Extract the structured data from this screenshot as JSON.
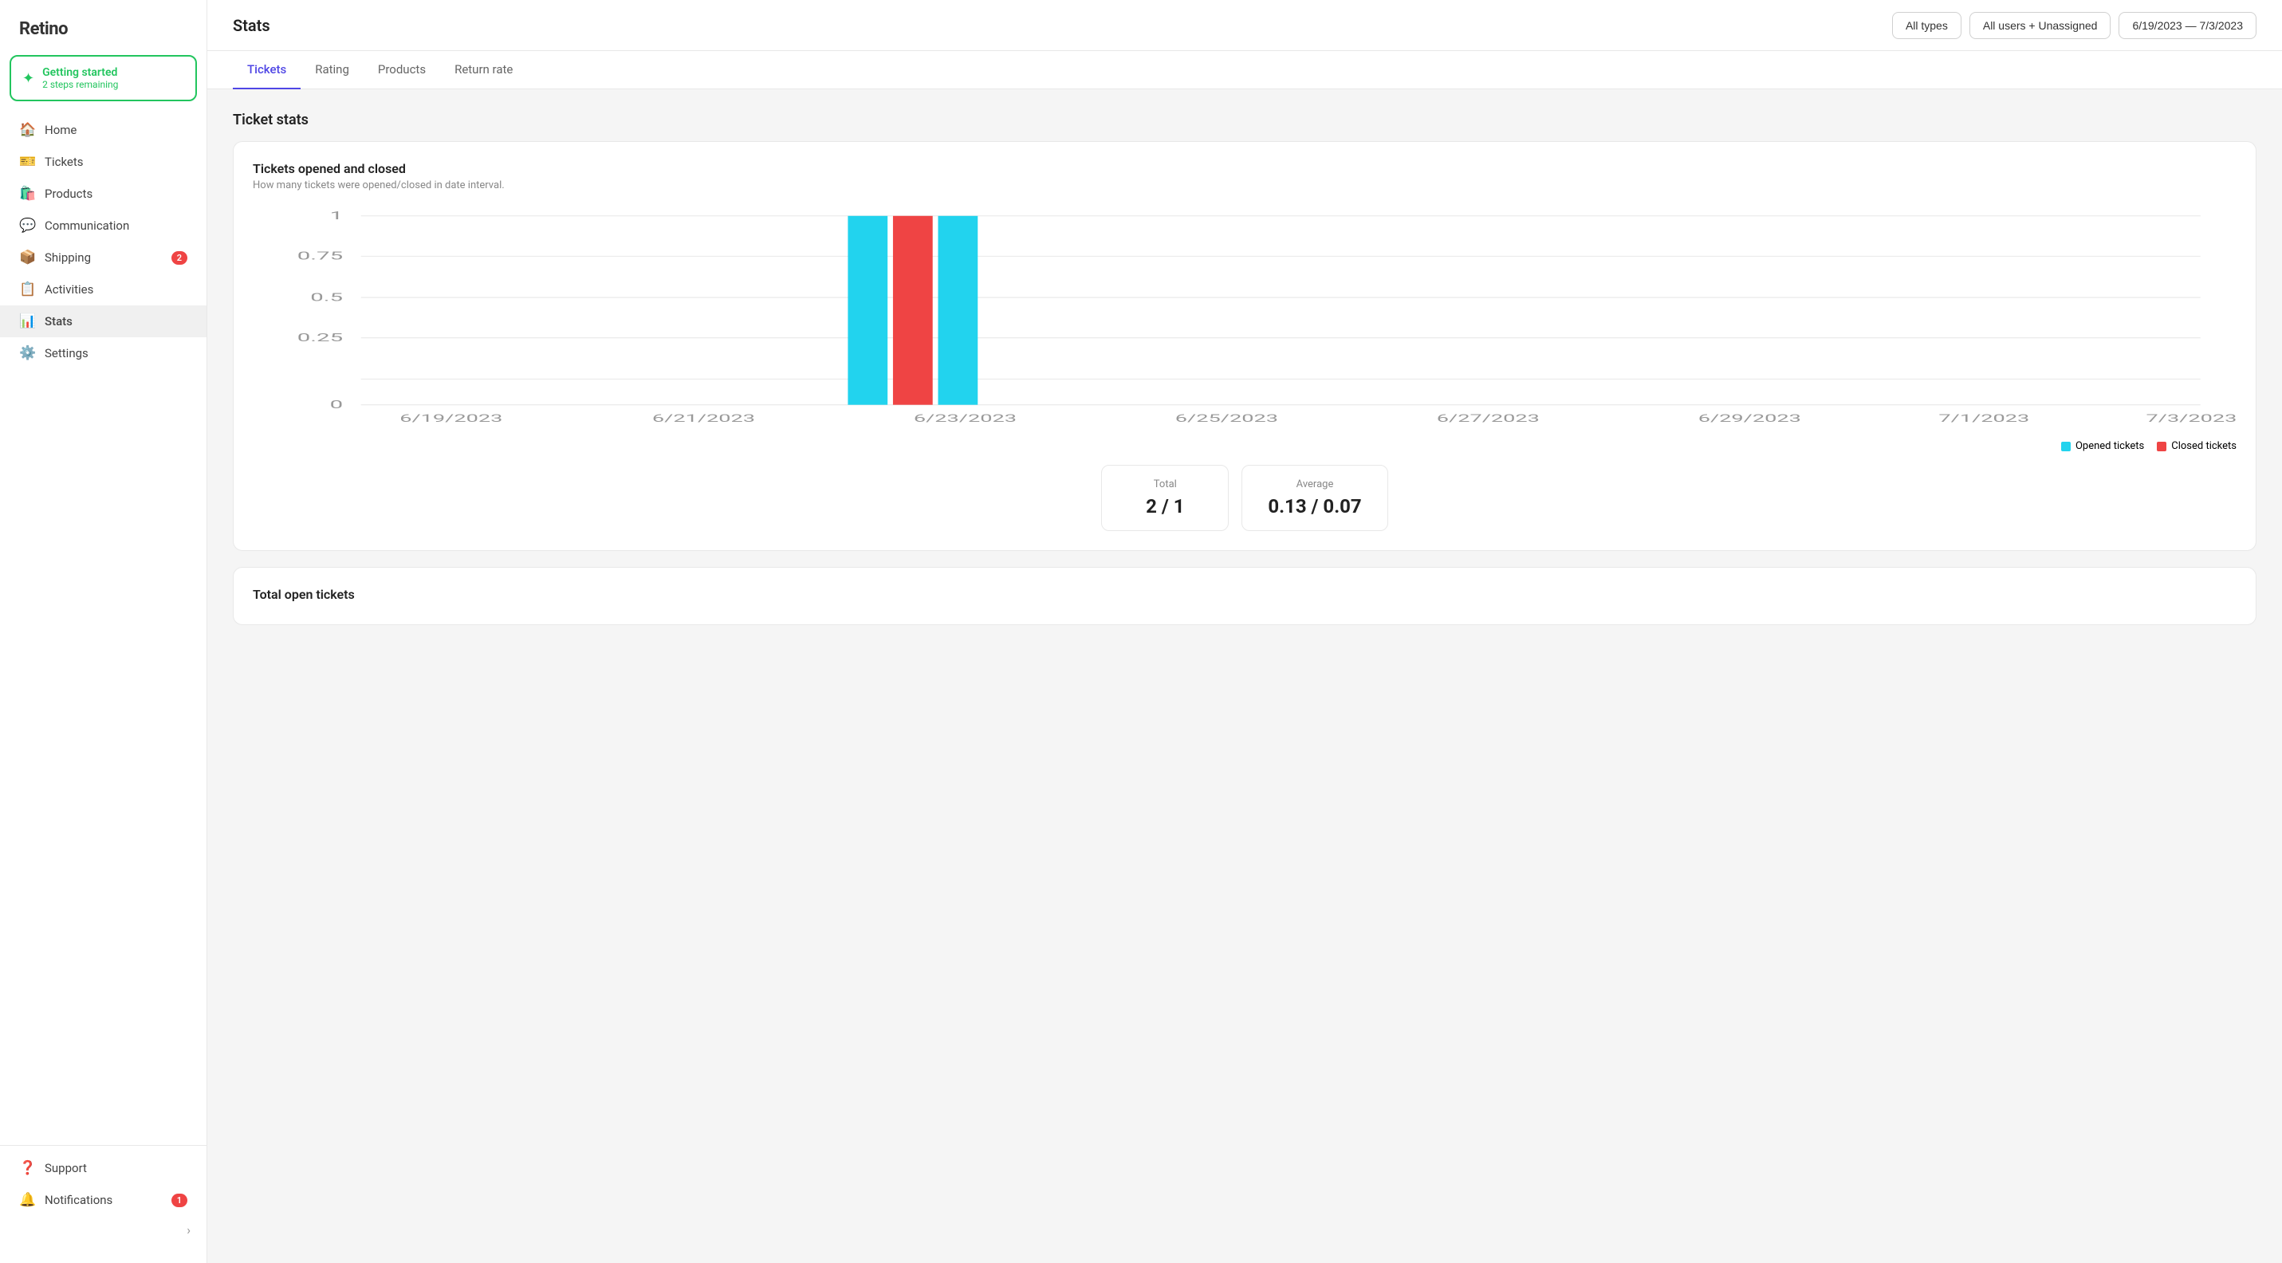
{
  "sidebar": {
    "logo": "Retino",
    "getting_started": {
      "title": "Getting started",
      "subtitle": "2 steps remaining"
    },
    "nav_items": [
      {
        "id": "home",
        "label": "Home",
        "icon": "🏠",
        "badge": null
      },
      {
        "id": "tickets",
        "label": "Tickets",
        "icon": "🎫",
        "badge": null
      },
      {
        "id": "products",
        "label": "Products",
        "icon": "🛍️",
        "badge": null
      },
      {
        "id": "communication",
        "label": "Communication",
        "icon": "💬",
        "badge": null
      },
      {
        "id": "shipping",
        "label": "Shipping",
        "icon": "📦",
        "badge": "2"
      },
      {
        "id": "activities",
        "label": "Activities",
        "icon": "📋",
        "badge": null
      },
      {
        "id": "stats",
        "label": "Stats",
        "icon": "📊",
        "badge": null,
        "active": true
      },
      {
        "id": "settings",
        "label": "Settings",
        "icon": "⚙️",
        "badge": null
      }
    ],
    "bottom_items": [
      {
        "id": "support",
        "label": "Support",
        "icon": "❓",
        "badge": null
      },
      {
        "id": "notifications",
        "label": "Notifications",
        "icon": "🔔",
        "badge": "1"
      }
    ]
  },
  "header": {
    "title": "Stats",
    "filters": {
      "type_label": "All types",
      "users_label": "All users + Unassigned",
      "date_label": "6/19/2023 — 7/3/2023"
    }
  },
  "tabs": [
    {
      "id": "tickets",
      "label": "Tickets",
      "active": true
    },
    {
      "id": "rating",
      "label": "Rating",
      "active": false
    },
    {
      "id": "products",
      "label": "Products",
      "active": false
    },
    {
      "id": "return_rate",
      "label": "Return rate",
      "active": false
    }
  ],
  "ticket_stats": {
    "section_title": "Ticket stats",
    "chart_title": "Tickets opened and closed",
    "chart_subtitle": "How many tickets were opened/closed in date interval.",
    "x_labels": [
      "6/19/2023",
      "6/21/2023",
      "6/23/2023",
      "6/25/2023",
      "6/27/2023",
      "6/29/2023",
      "7/1/2023",
      "7/3/2023"
    ],
    "y_labels": [
      "0",
      "0.25",
      "0.5",
      "0.75",
      "1"
    ],
    "legend": {
      "opened_label": "Opened tickets",
      "opened_color": "#22d3ee",
      "closed_label": "Closed tickets",
      "closed_color": "#ef4444"
    },
    "total": {
      "label": "Total",
      "value": "2 / 1"
    },
    "average": {
      "label": "Average",
      "value": "0.13 / 0.07"
    }
  },
  "total_open": {
    "label": "Total open tickets"
  }
}
